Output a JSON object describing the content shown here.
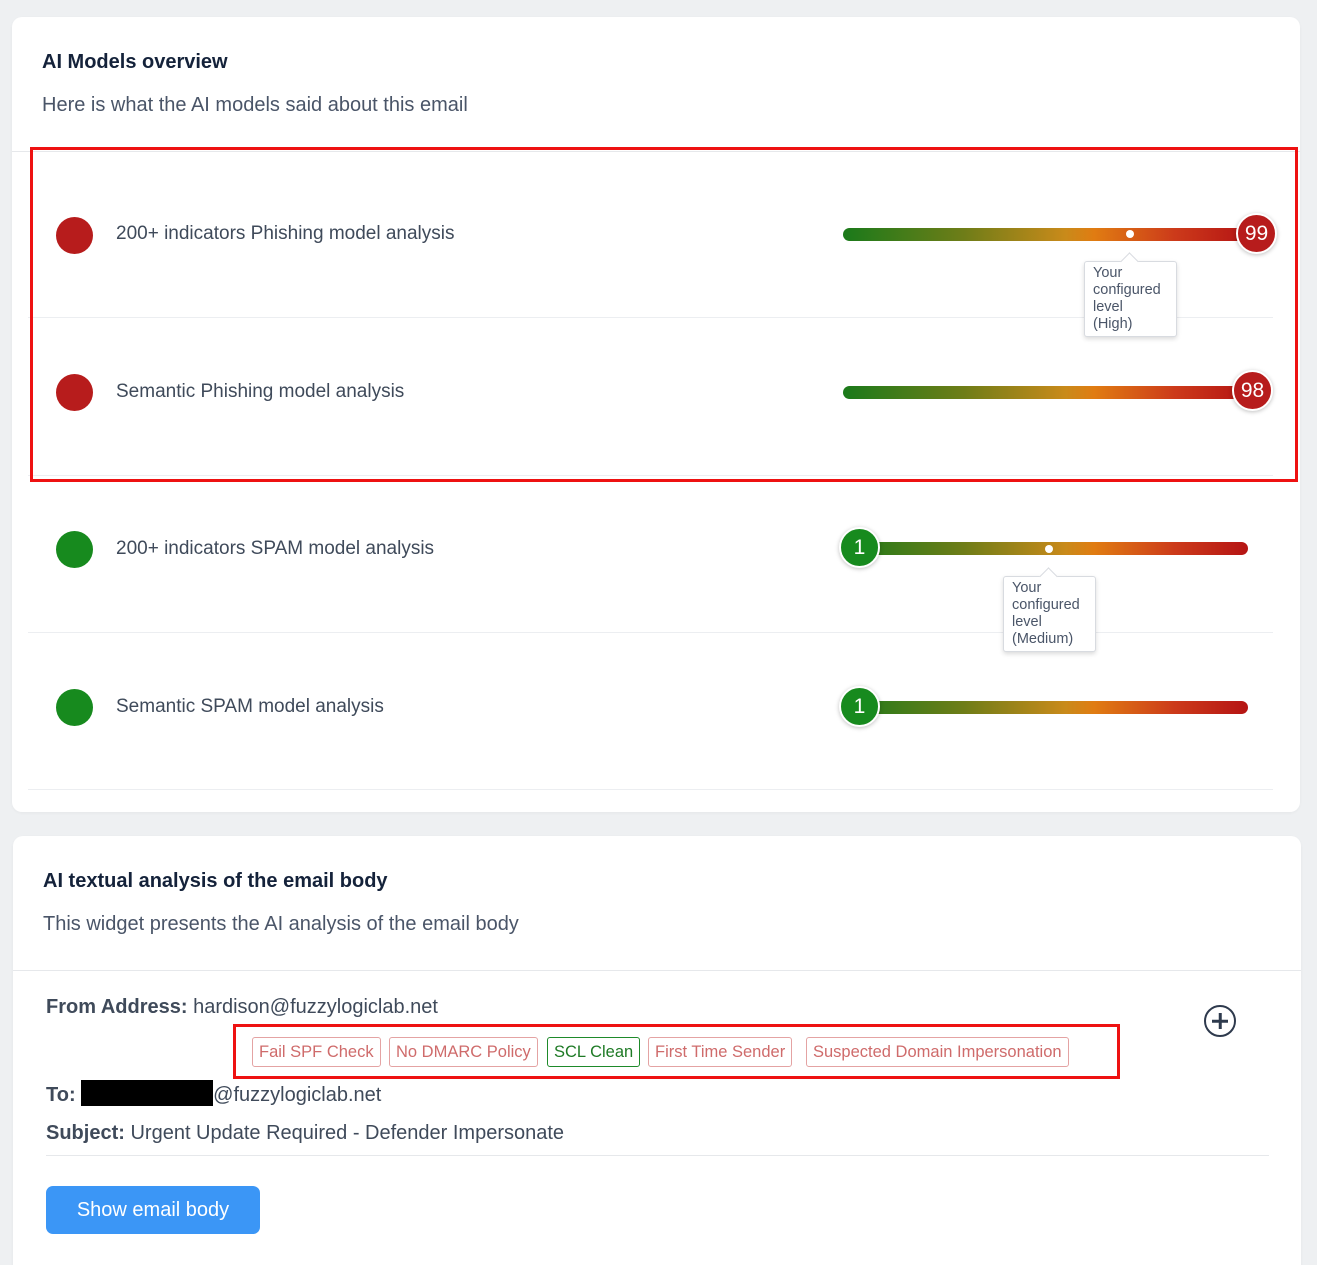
{
  "overview": {
    "title": "AI Models overview",
    "subtitle": "Here is what the AI models said about this email",
    "models": [
      {
        "label": "200+ indicators Phishing model analysis",
        "score": "99",
        "status_color": "#b71c1c",
        "tooltip": [
          "Your",
          "configured",
          "level",
          "(High)"
        ]
      },
      {
        "label": "Semantic Phishing model analysis",
        "score": "98",
        "status_color": "#b71c1c"
      },
      {
        "label": "200+ indicators SPAM model analysis",
        "score": "1",
        "status_color": "#178a1e",
        "tooltip": [
          "Your",
          "configured",
          "level",
          "(Medium)"
        ]
      },
      {
        "label": "Semantic SPAM model analysis",
        "score": "1",
        "status_color": "#178a1e"
      }
    ]
  },
  "textual": {
    "title": "AI textual analysis of the email body",
    "subtitle": "This widget presents the AI analysis of the email body",
    "from_label": "From Address:",
    "from_value": "hardison@fuzzylogiclab.net",
    "to_label": "To:",
    "to_value": "@fuzzylogiclab.net",
    "subject_label": "Subject:",
    "subject_value": "Urgent Update Required - Defender Impersonate",
    "tags": [
      "Fail SPF Check",
      "No DMARC Policy",
      "SCL Clean",
      "First Time Sender",
      "Suspected Domain Impersonation"
    ],
    "show_body_label": "Show email body"
  },
  "colors": {
    "danger": "#b71c1c",
    "safe": "#178a1e",
    "highlight": "#ee1111",
    "primary": "#3b96f6"
  }
}
